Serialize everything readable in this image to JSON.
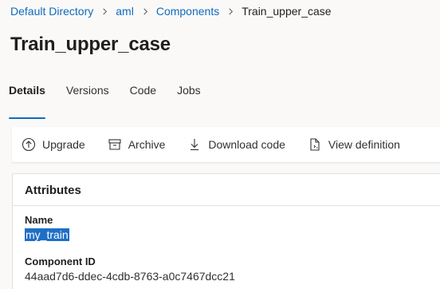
{
  "breadcrumb": {
    "items": [
      "Default Directory",
      "aml",
      "Components"
    ],
    "current": "Train_upper_case"
  },
  "page": {
    "title": "Train_upper_case"
  },
  "tabs": [
    {
      "label": "Details",
      "active": true
    },
    {
      "label": "Versions",
      "active": false
    },
    {
      "label": "Code",
      "active": false
    },
    {
      "label": "Jobs",
      "active": false
    }
  ],
  "toolbar": {
    "upgrade_label": "Upgrade",
    "archive_label": "Archive",
    "download_label": "Download code",
    "view_definition_label": "View definition"
  },
  "attributes": {
    "header": "Attributes",
    "name_label": "Name",
    "name_value": "my_train",
    "component_id_label": "Component ID",
    "component_id_value": "44aad7d6-ddec-4cdb-8763-a0c7467dcc21"
  },
  "colors": {
    "link": "#0f6cbd",
    "tab_indicator": "#0f6cbd",
    "selection": "#1f6fc7",
    "background": "#faf9f8"
  },
  "icons": {
    "separator": "chevron-right-icon",
    "upgrade": "arrow-up-circle-icon",
    "archive": "archive-icon",
    "download": "download-icon",
    "view_definition": "document-code-icon"
  }
}
